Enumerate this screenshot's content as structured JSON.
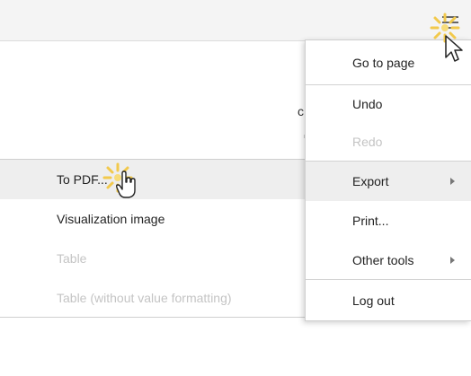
{
  "background": {
    "partial_text": "c"
  },
  "menu": {
    "items": [
      {
        "label": "Go to page",
        "state": "normal"
      },
      {
        "label": "Undo",
        "state": "normal"
      },
      {
        "label": "Redo",
        "state": "disabled"
      },
      {
        "label": "Export",
        "state": "hover",
        "has_submenu": true
      },
      {
        "label": "Print...",
        "state": "normal"
      },
      {
        "label": "Other tools",
        "state": "normal",
        "has_submenu": true
      },
      {
        "label": "Log out",
        "state": "normal"
      }
    ]
  },
  "export_submenu": {
    "items": [
      {
        "label": "To PDF...",
        "state": "hover"
      },
      {
        "label": "Visualization image",
        "state": "normal"
      },
      {
        "label": "Table",
        "state": "disabled"
      },
      {
        "label": "Table (without value formatting)",
        "state": "disabled"
      }
    ]
  },
  "icons": {
    "menu": "hamburger-menu-icon",
    "submenu_arrow": "chevron-right-icon",
    "pointer": "arrow-cursor-icon",
    "hand": "hand-cursor-icon",
    "highlight": "click-burst-icon"
  },
  "colors": {
    "hover_bg": "#eeeeee",
    "disabled_text": "#c4c4c4",
    "click_burst": "#f2c94c"
  }
}
